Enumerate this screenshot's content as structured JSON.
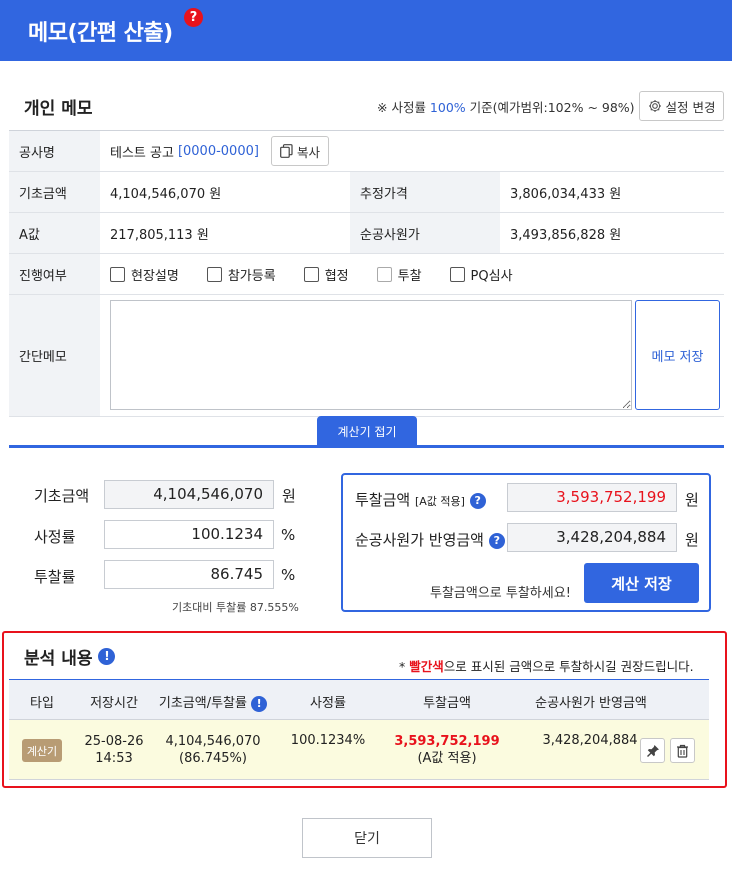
{
  "header": {
    "title": "메모(간편 산출)",
    "help_badge": "?"
  },
  "memo_section": {
    "title": "개인 메모",
    "rate_note_prefix": "※ 사정률 ",
    "rate_note_value": "100%",
    "rate_note_suffix": " 기준(예가범위:102% ~ 98%)",
    "settings_label": "설정 변경"
  },
  "info": {
    "project_label": "공사명",
    "project_name": "테스트 공고",
    "project_code": "[0000-0000]",
    "copy_label": "복사",
    "base_label": "기초금액",
    "base_value": "4,104,546,070 원",
    "est_label": "추정가격",
    "est_value": "3,806,034,433 원",
    "a_label": "A값",
    "a_value": "217,805,113 원",
    "net_label": "순공사원가",
    "net_value": "3,493,856,828 원",
    "progress_label": "진행여부",
    "progress_items": [
      "현장설명",
      "참가등록",
      "협정",
      "투찰",
      "PQ심사"
    ],
    "memo_label": "간단메모",
    "memo_save": "메모 저장"
  },
  "fold_label": "계산기 접기",
  "calc": {
    "base_label": "기초금액",
    "base_value": "4,104,546,070",
    "base_unit": "원",
    "rate_label": "사정률",
    "rate_value": "100.1234",
    "rate_unit": "%",
    "bid_rate_label": "투찰률",
    "bid_rate_value": "86.745",
    "bid_rate_unit": "%",
    "ratio_note": "기초대비 투찰률 87.555%",
    "bid_amount_label": "투찰금액",
    "bid_amount_sub": "[A값 적용]",
    "bid_amount_value": "3,593,752,199",
    "bid_amount_unit": "원",
    "net_reflect_label": "순공사원가 반영금액",
    "net_reflect_value": "3,428,204,884",
    "net_reflect_unit": "원",
    "hint": "투찰금액으로 투찰하세요!",
    "save_label": "계산 저장"
  },
  "analysis": {
    "title": "분석 내용",
    "note_prefix": "* ",
    "note_red": "빨간색",
    "note_suffix": "으로 표시된 금액으로 투찰하시길 권장드립니다.",
    "columns": [
      "타입",
      "저장시간",
      "기초금액/투찰률",
      "사정률",
      "투찰금액",
      "순공사원가 반영금액"
    ],
    "row": {
      "type": "계산기",
      "date": "25-08-26",
      "time": "14:53",
      "base": "4,104,546,070",
      "bid_rate": "(86.745%)",
      "rate": "100.1234%",
      "bid_amount": "3,593,752,199",
      "bid_amount_sub": "(A값 적용)",
      "net_reflect": "3,428,204,884"
    }
  },
  "close_label": "닫기",
  "colors": {
    "primary": "#3166e0",
    "danger": "#e8121c",
    "highlight_row": "#fbfbdf"
  }
}
